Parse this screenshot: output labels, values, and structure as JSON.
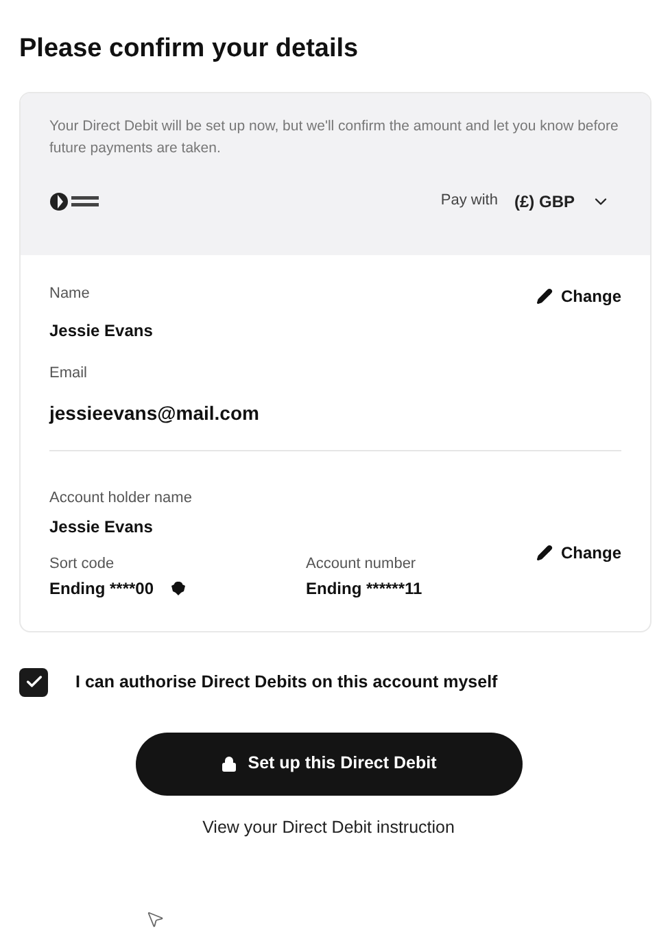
{
  "title": "Please confirm your details",
  "notice": {
    "text": "Your Direct Debit will be set up now, but we'll confirm the amount and let you know before future payments are taken.",
    "pay_with_label": "Pay with",
    "currency": "(£) GBP"
  },
  "contact": {
    "fields": [
      {
        "label": "Name",
        "value": "Jessie Evans",
        "kind": "normal"
      },
      {
        "label": "Email",
        "value": "jessieevans@mail.com",
        "kind": "large"
      }
    ],
    "change": "Change"
  },
  "account": {
    "holder_label": "Account holder name",
    "holder_value": "Jessie Evans",
    "sort_code_label": "Sort code",
    "sort_code_value": "Ending ****00",
    "account_number_label": "Account number",
    "account_number_value": "Ending ******11",
    "change": "Change"
  },
  "authorise": {
    "label": "I can authorise Direct Debits on this account myself",
    "checked": true
  },
  "submit": "Set up this Direct Debit",
  "instruction_link": "View your Direct Debit instruction"
}
